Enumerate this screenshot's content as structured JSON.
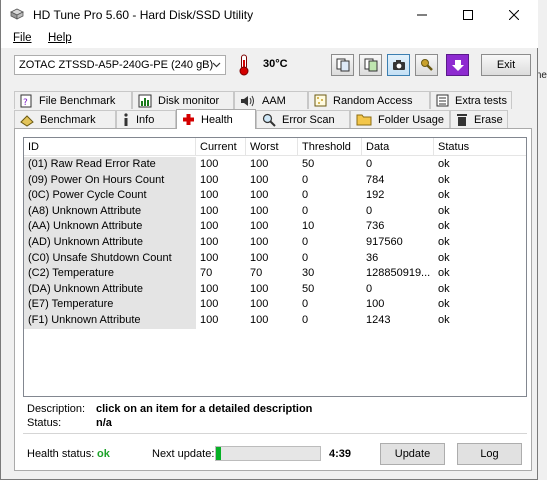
{
  "window": {
    "title": "HD Tune Pro 5.60 - Hard Disk/SSD Utility"
  },
  "menu": {
    "file": "File",
    "help": "Help"
  },
  "toolbar": {
    "drive": "ZOTAC ZTSSD-A5P-240G-PE (240 gB)",
    "temperature": "30°C",
    "exit_label": "Exit"
  },
  "tabs_top": [
    "File Benchmark",
    "Disk monitor",
    "AAM",
    "Random Access",
    "Extra tests"
  ],
  "tabs_bottom": [
    "Benchmark",
    "Info",
    "Health",
    "Error Scan",
    "Folder Usage",
    "Erase"
  ],
  "active_tab": "Health",
  "table": {
    "headers": [
      "ID",
      "Current",
      "Worst",
      "Threshold",
      "Data",
      "Status"
    ],
    "rows": [
      [
        "(01) Raw Read Error Rate",
        "100",
        "100",
        "50",
        "0",
        "ok"
      ],
      [
        "(09) Power On Hours Count",
        "100",
        "100",
        "0",
        "784",
        "ok"
      ],
      [
        "(0C) Power Cycle Count",
        "100",
        "100",
        "0",
        "192",
        "ok"
      ],
      [
        "(A8) Unknown Attribute",
        "100",
        "100",
        "0",
        "0",
        "ok"
      ],
      [
        "(AA) Unknown Attribute",
        "100",
        "100",
        "10",
        "736",
        "ok"
      ],
      [
        "(AD) Unknown Attribute",
        "100",
        "100",
        "0",
        "917560",
        "ok"
      ],
      [
        "(C0) Unsafe Shutdown Count",
        "100",
        "100",
        "0",
        "36",
        "ok"
      ],
      [
        "(C2) Temperature",
        "70",
        "70",
        "30",
        "128850919...",
        "ok"
      ],
      [
        "(DA) Unknown Attribute",
        "100",
        "100",
        "50",
        "0",
        "ok"
      ],
      [
        "(E7) Temperature",
        "100",
        "100",
        "0",
        "100",
        "ok"
      ],
      [
        "(F1) Unknown Attribute",
        "100",
        "100",
        "0",
        "1243",
        "ok"
      ]
    ]
  },
  "description": {
    "label": "Description:",
    "value": "click on an item for a detailed description"
  },
  "status": {
    "label": "Status:",
    "value": "n/a"
  },
  "health": {
    "label": "Health status:",
    "value": "ok"
  },
  "next_update": {
    "label": "Next update:",
    "progress": 0.05,
    "time": "4:39"
  },
  "buttons": {
    "update": "Update",
    "log": "Log"
  },
  "background_fragments": [
    "ck",
    "di",
    "ar",
    "ak",
    "Te",
    "Fi",
    "D",
    "P"
  ],
  "background_fragments_right": [
    "ne"
  ],
  "colors": {
    "ok_green": "#1ea32a",
    "progress_green": "#06b025",
    "id_column_bg": "#e4e4e4"
  }
}
